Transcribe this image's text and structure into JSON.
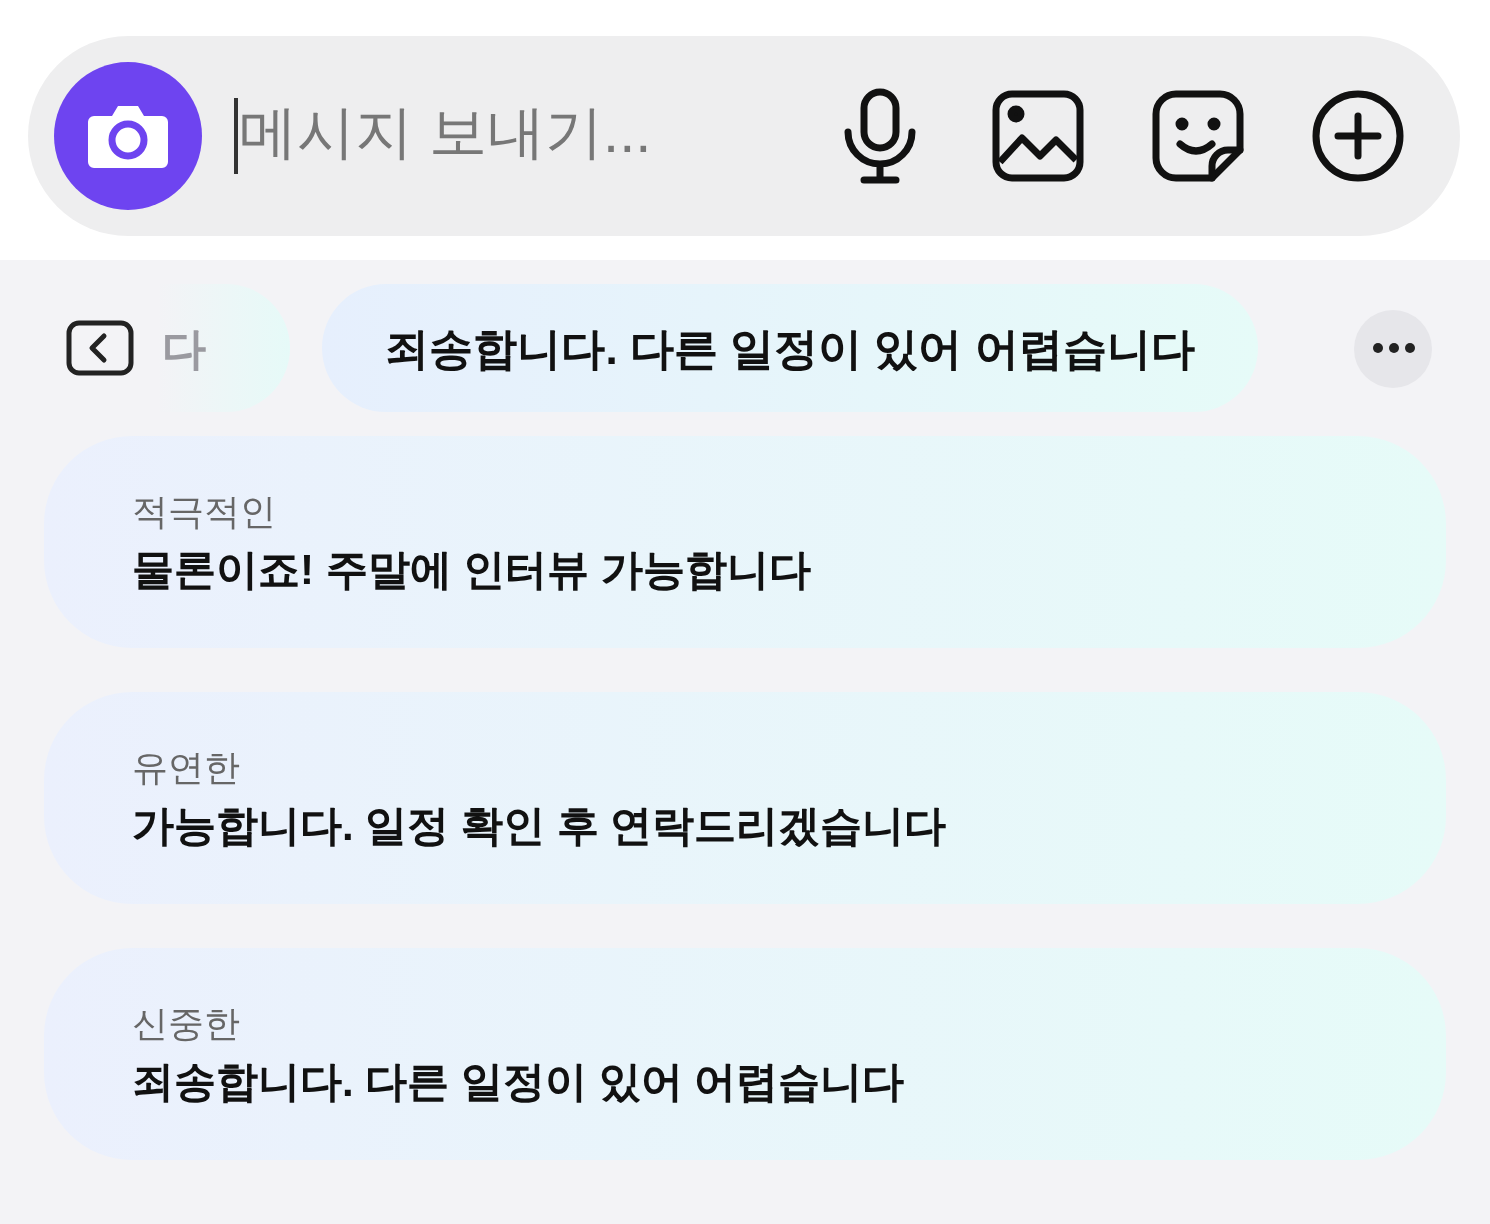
{
  "message_field": {
    "placeholder": "메시지 보내기..."
  },
  "suggestion_chips": [
    {
      "text": "다",
      "partial": true
    },
    {
      "text": "죄송합니다. 다른 일정이 있어 어렵습니다",
      "partial": false
    }
  ],
  "replies": [
    {
      "tone": "적극적인",
      "text": "물론이죠! 주말에 인터뷰 가능합니다"
    },
    {
      "tone": "유연한",
      "text": "가능합니다. 일정 확인 후 연락드리겠습니다"
    },
    {
      "tone": "신중한",
      "text": "죄송합니다. 다른 일정이 있어 어렵습니다"
    }
  ]
}
